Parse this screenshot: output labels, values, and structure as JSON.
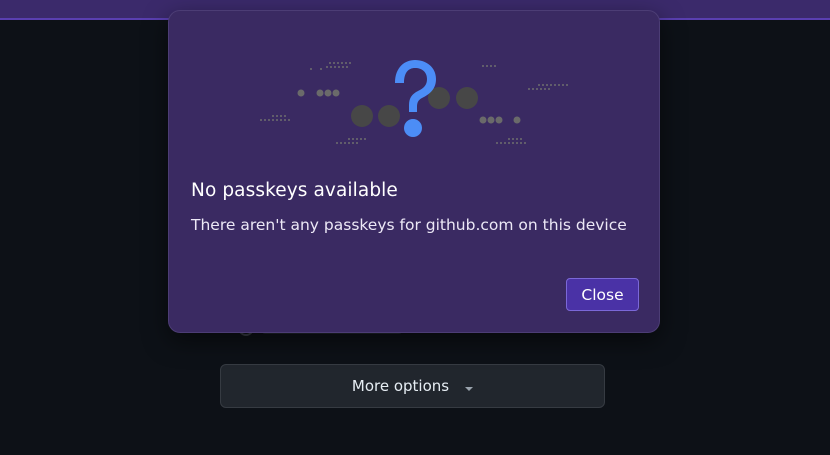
{
  "dialog": {
    "title": "No passkeys available",
    "message": "There aren't any passkeys for github.com on this device",
    "close_label": "Close",
    "illustration_icon": "question-mark-icon",
    "accent_color": "#4c8df6",
    "background_color": "#3a2a62"
  },
  "background": {
    "more_options_label": "More options",
    "more_options_icon": "caret-down-icon"
  }
}
